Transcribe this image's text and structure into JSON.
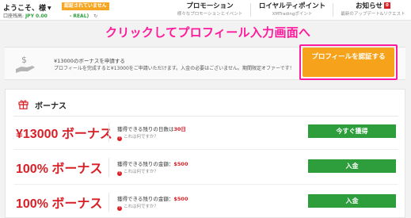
{
  "header": {
    "welcome_text": "ようこそ、様",
    "unverified_badge": "認証されていません",
    "account_label": "口座残高:",
    "balance": "JPY 0.00",
    "account_type": "- REAL)",
    "nav": [
      {
        "title": "プロモーション",
        "sub": "様々なプロモーションとイベント"
      },
      {
        "title": "ロイヤルティポイント",
        "sub": "XMTradingポイント"
      },
      {
        "title": "お知らせ",
        "badge": "0",
        "sub": "最新のアップデート&リクエスト"
      }
    ]
  },
  "annotation": {
    "text": "クリックしてプロフィール入力画面へ",
    "color": "#ff1a9c"
  },
  "notice": {
    "title": "¥13000のボーナスを申請する",
    "description": "プロフィールを完成すると¥13000をご申請いただけます。入金の必要はございません。期間限定オファーです！",
    "verify_button": "プロフィールを認証する"
  },
  "bonus_panel": {
    "title": "ボーナス",
    "rows": [
      {
        "amount": "¥13000 ボーナス",
        "condition_label": "獲得できる残りの日数は",
        "condition_value": "30日",
        "help": "これは何ですか？",
        "button": "今すぐ獲得"
      },
      {
        "amount": "100% ボーナス",
        "condition_label": "獲得できる残りの金額：",
        "condition_value": "$500",
        "help": "これは何ですか？",
        "button": "入金"
      },
      {
        "amount": "100% ボーナス",
        "condition_label": "獲得できる残りの金額：",
        "condition_value": "$500",
        "help": "これは何ですか？",
        "button": "入金"
      }
    ]
  },
  "colors": {
    "accent_red": "#d81f26",
    "green": "#2e9e3c",
    "orange": "#f7a21b",
    "pink": "#ff1a9c"
  }
}
